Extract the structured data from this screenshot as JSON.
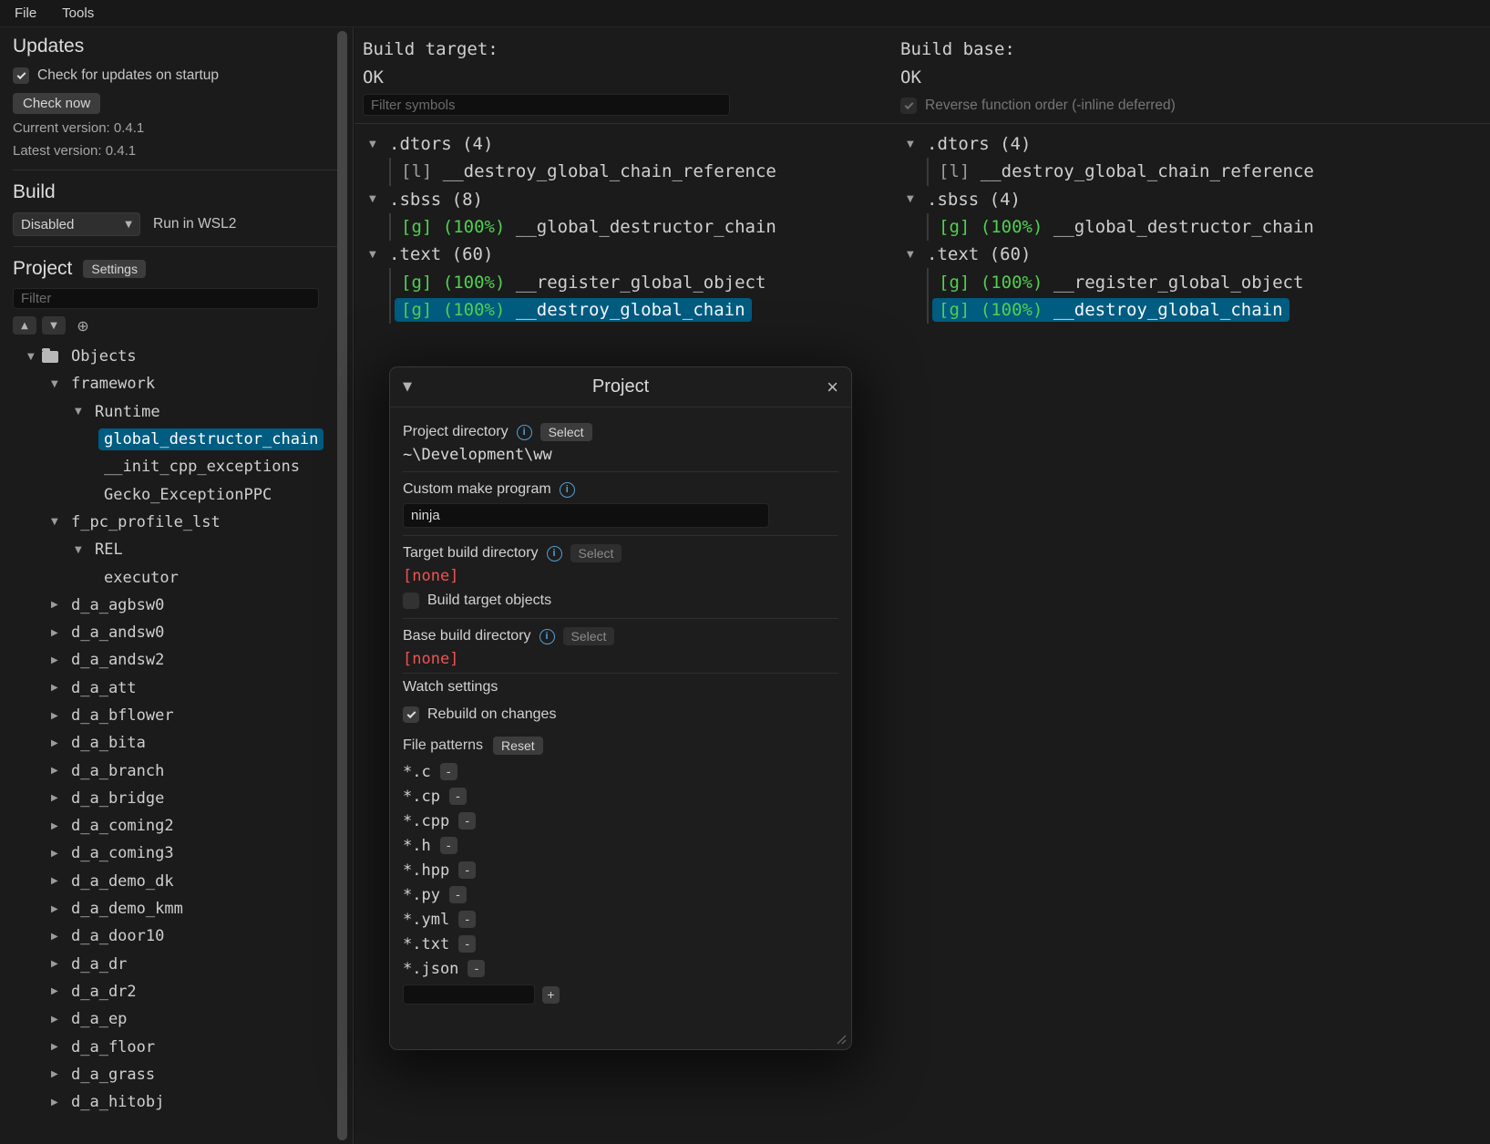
{
  "colors": {
    "selection_bg": "#005c80",
    "match_green": "#50d050",
    "error_red": "#ef5350",
    "info_blue": "#519fd6"
  },
  "icons": {
    "chevron_down": "▼",
    "chevron_right": "▶",
    "arrow_up": "▲",
    "arrow_down": "▼",
    "locate": "⊕",
    "close": "×",
    "collapse": "▼",
    "info": "i",
    "minus": "-",
    "plus": "+"
  },
  "menu": {
    "file": "File",
    "tools": "Tools"
  },
  "sidebar": {
    "updates": {
      "title": "Updates",
      "check_on_startup_label": "Check for updates on startup",
      "check_now_label": "Check now",
      "current_version": "Current version: 0.4.1",
      "latest_version": "Latest version: 0.4.1"
    },
    "build": {
      "title": "Build",
      "mode": "Disabled",
      "wsl_label": "Run in WSL2"
    },
    "project": {
      "title": "Project",
      "settings_label": "Settings",
      "filter_placeholder": "Filter",
      "tree": [
        {
          "label": "Objects",
          "depth": 0,
          "state": "expanded",
          "icon": "folder"
        },
        {
          "label": "framework",
          "depth": 1,
          "state": "expanded"
        },
        {
          "label": "Runtime",
          "depth": 2,
          "state": "expanded"
        },
        {
          "label": "global_destructor_chain",
          "depth": 3,
          "state": "leaf",
          "selected": true
        },
        {
          "label": "__init_cpp_exceptions",
          "depth": 3,
          "state": "leaf"
        },
        {
          "label": "Gecko_ExceptionPPC",
          "depth": 3,
          "state": "leaf"
        },
        {
          "label": "f_pc_profile_lst",
          "depth": 1,
          "state": "expanded"
        },
        {
          "label": "REL",
          "depth": 2,
          "state": "expanded"
        },
        {
          "label": "executor",
          "depth": 3,
          "state": "leaf"
        },
        {
          "label": "d_a_agbsw0",
          "depth": 1,
          "state": "collapsed"
        },
        {
          "label": "d_a_andsw0",
          "depth": 1,
          "state": "collapsed"
        },
        {
          "label": "d_a_andsw2",
          "depth": 1,
          "state": "collapsed"
        },
        {
          "label": "d_a_att",
          "depth": 1,
          "state": "collapsed"
        },
        {
          "label": "d_a_bflower",
          "depth": 1,
          "state": "collapsed"
        },
        {
          "label": "d_a_bita",
          "depth": 1,
          "state": "collapsed"
        },
        {
          "label": "d_a_branch",
          "depth": 1,
          "state": "collapsed"
        },
        {
          "label": "d_a_bridge",
          "depth": 1,
          "state": "collapsed"
        },
        {
          "label": "d_a_coming2",
          "depth": 1,
          "state": "collapsed"
        },
        {
          "label": "d_a_coming3",
          "depth": 1,
          "state": "collapsed"
        },
        {
          "label": "d_a_demo_dk",
          "depth": 1,
          "state": "collapsed"
        },
        {
          "label": "d_a_demo_kmm",
          "depth": 1,
          "state": "collapsed"
        },
        {
          "label": "d_a_door10",
          "depth": 1,
          "state": "collapsed"
        },
        {
          "label": "d_a_dr",
          "depth": 1,
          "state": "collapsed"
        },
        {
          "label": "d_a_dr2",
          "depth": 1,
          "state": "collapsed"
        },
        {
          "label": "d_a_ep",
          "depth": 1,
          "state": "collapsed"
        },
        {
          "label": "d_a_floor",
          "depth": 1,
          "state": "collapsed"
        },
        {
          "label": "d_a_grass",
          "depth": 1,
          "state": "collapsed"
        },
        {
          "label": "d_a_hitobj",
          "depth": 1,
          "state": "collapsed"
        }
      ]
    }
  },
  "target_panel": {
    "title": "Build target:",
    "status": "OK",
    "filter_placeholder": "Filter symbols",
    "sections": [
      {
        "name": ".dtors (4)",
        "symbols": [
          {
            "kind": "[l]",
            "match": "",
            "name": "__destroy_global_chain_reference"
          }
        ]
      },
      {
        "name": ".sbss (8)",
        "symbols": [
          {
            "kind": "[g]",
            "match": "(100%)",
            "name": "__global_destructor_chain"
          }
        ]
      },
      {
        "name": ".text (60)",
        "symbols": [
          {
            "kind": "[g]",
            "match": "(100%)",
            "name": "__register_global_object"
          },
          {
            "kind": "[g]",
            "match": "(100%)",
            "name": "__destroy_global_chain",
            "selected": true
          }
        ]
      }
    ]
  },
  "base_panel": {
    "title": "Build base:",
    "status": "OK",
    "reverse_label": "Reverse function order (-inline deferred)",
    "sections": [
      {
        "name": ".dtors (4)",
        "symbols": [
          {
            "kind": "[l]",
            "match": "",
            "name": "__destroy_global_chain_reference"
          }
        ]
      },
      {
        "name": ".sbss (4)",
        "symbols": [
          {
            "kind": "[g]",
            "match": "(100%)",
            "name": "__global_destructor_chain"
          }
        ]
      },
      {
        "name": ".text (60)",
        "symbols": [
          {
            "kind": "[g]",
            "match": "(100%)",
            "name": "__register_global_object"
          },
          {
            "kind": "[g]",
            "match": "(100%)",
            "name": "__destroy_global_chain",
            "selected": true
          }
        ]
      }
    ]
  },
  "dialog": {
    "title": "Project",
    "project_directory": {
      "label": "Project directory",
      "select_label": "Select",
      "value": "~\\Development\\ww"
    },
    "custom_make": {
      "label": "Custom make program",
      "value": "ninja"
    },
    "target_build_dir": {
      "label": "Target build directory",
      "select_label": "Select",
      "value": "[none]",
      "checkbox_label": "Build target objects"
    },
    "base_build_dir": {
      "label": "Base build directory",
      "select_label": "Select",
      "value": "[none]"
    },
    "watch": {
      "title": "Watch settings",
      "rebuild_label": "Rebuild on changes",
      "file_patterns_label": "File patterns",
      "reset_label": "Reset",
      "patterns": [
        "*.c",
        "*.cp",
        "*.cpp",
        "*.h",
        "*.hpp",
        "*.py",
        "*.yml",
        "*.txt",
        "*.json"
      ]
    }
  }
}
